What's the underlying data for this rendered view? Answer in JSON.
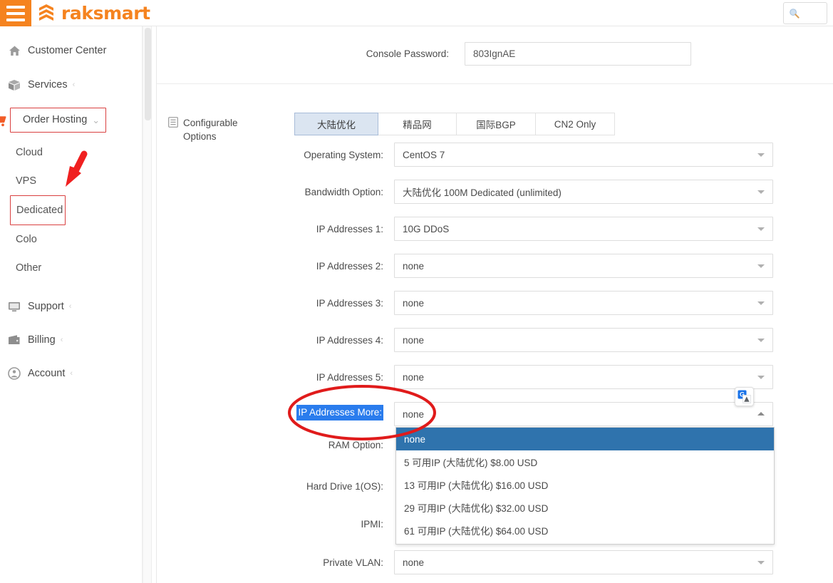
{
  "header": {
    "brand": "raksmart",
    "menu_icon": "hamburger-icon",
    "search": {
      "value": "",
      "placeholder": "",
      "icon": "search-icon"
    }
  },
  "sidebar": {
    "items": [
      {
        "label": "Customer Center",
        "icon": "home-icon",
        "chevron": "",
        "boxed": false
      },
      {
        "label": "Services",
        "icon": "box-icon",
        "chevron": "‹",
        "boxed": false
      },
      {
        "label": "Order Hosting",
        "icon": "cart-icon",
        "chevron": "⌄",
        "boxed": true
      }
    ],
    "sub_items": [
      {
        "label": "Cloud",
        "boxed": false
      },
      {
        "label": "VPS",
        "boxed": false
      },
      {
        "label": "Dedicated",
        "boxed": true
      },
      {
        "label": "Colo",
        "boxed": false
      },
      {
        "label": "Other",
        "boxed": false
      }
    ],
    "bottom_items": [
      {
        "label": "Support",
        "icon": "monitor-icon",
        "chevron": "‹"
      },
      {
        "label": "Billing",
        "icon": "wallet-icon",
        "chevron": "‹"
      },
      {
        "label": "Account",
        "icon": "user-circle-icon",
        "chevron": "‹"
      }
    ]
  },
  "main": {
    "console_password": {
      "label": "Console Password:",
      "value": "803IgnAE"
    },
    "configurable_options": {
      "icon": "document-list-icon",
      "label_line1": "Configurable",
      "label_line2": "Options"
    },
    "tabs": [
      {
        "label": "大陆优化",
        "active": true
      },
      {
        "label": "精品网",
        "active": false
      },
      {
        "label": "国际BGP",
        "active": false
      },
      {
        "label": "CN2 Only",
        "active": false
      }
    ],
    "fields": [
      {
        "label": "Operating System:",
        "value": "CentOS 7"
      },
      {
        "label": "Bandwidth Option:",
        "value": "大陆优化 100M Dedicated (unlimited)"
      },
      {
        "label": "IP Addresses 1:",
        "value": "10G DDoS"
      },
      {
        "label": "IP Addresses 2:",
        "value": "none"
      },
      {
        "label": "IP Addresses 3:",
        "value": "none"
      },
      {
        "label": "IP Addresses 4:",
        "value": "none"
      },
      {
        "label": "IP Addresses 5:",
        "value": "none"
      }
    ],
    "open_field": {
      "label": "IP Addresses More:",
      "value": "none",
      "label_selected": true,
      "options": [
        {
          "text": "none",
          "selected": true
        },
        {
          "text": "5 可用IP (大陆优化) $8.00 USD",
          "selected": false
        },
        {
          "text": "13 可用IP (大陆优化) $16.00 USD",
          "selected": false
        },
        {
          "text": "29 可用IP (大陆优化) $32.00 USD",
          "selected": false
        },
        {
          "text": "61 可用IP (大陆优化) $64.00 USD",
          "selected": false
        }
      ]
    },
    "hidden_labels": [
      {
        "label": "RAM Option:"
      },
      {
        "label": "Hard Drive 1(OS):"
      },
      {
        "label": "IPMI:"
      }
    ],
    "last_field": {
      "label": "Private VLAN:",
      "value": "none"
    }
  },
  "overlays": {
    "translate_icon": "google-translate-icon",
    "annotation_color": "#e02020",
    "highlight_color": "#2a7ced",
    "brand_color": "#f5831f",
    "dropdown_selected_color": "#2f73ad",
    "tab_active_color": "#dbe5f1"
  }
}
